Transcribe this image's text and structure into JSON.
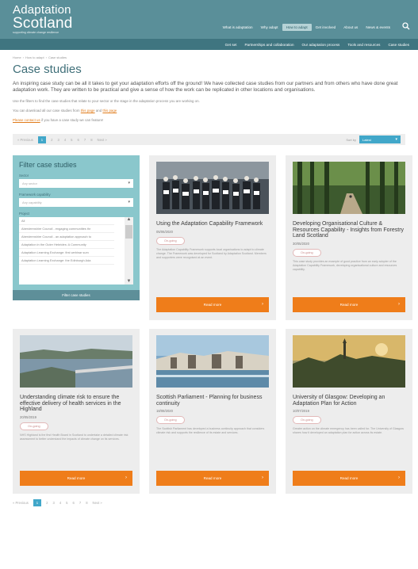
{
  "header": {
    "logo_line1": "Adaptation",
    "logo_line2": "Scotland",
    "logo_tagline": "supporting climate change resilience",
    "nav": [
      "What is adaptation",
      "Why adapt",
      "How to adapt",
      "Get involved",
      "About us",
      "News & events"
    ],
    "nav_active_index": 2,
    "subnav": [
      "Get set",
      "Partnerships and collaboration",
      "Our adaptation process",
      "Tools and resources",
      "Case studies"
    ]
  },
  "breadcrumb": [
    "Home",
    "How to adapt",
    "Case studies"
  ],
  "page": {
    "title": "Case studies",
    "intro": "An inspiring case study can be all it takes to get your adaptation efforts off the ground! We have collected case studies from our partners and from others who have done great adaptation work. They are written to be practical and give a sense of how the work can be replicated in other locations and organisations.",
    "filter_hint": "Use the filters to find the case studies that relate to your sector or the stage in the adaptation process you are working on.",
    "download_text": "You can download all our case studies from",
    "download_link1": "this page",
    "download_and": "and",
    "download_link2": "this page",
    "contact_link": "Please contact us",
    "contact_text": "if you have a case study we can feature!"
  },
  "pager": {
    "prev": "« Previous",
    "pages": [
      "1",
      "2",
      "3",
      "4",
      "5",
      "6",
      "7",
      "8"
    ],
    "current": "1",
    "next": "Next »",
    "sort_label": "Sort by",
    "sort_value": "Latest"
  },
  "filter": {
    "title": "Filter case studies",
    "sector_label": "Sector",
    "sector_placeholder": "Any sector",
    "capability_label": "Framework capability",
    "capability_placeholder": "Any capability",
    "project_label": "Project",
    "projects": [
      "All",
      "Aberdeenshire Council - engaging communities thr",
      "Aberdeenshire Council - an adaptation approach to",
      "Adaptation in the Outer Hebrides: A Community",
      "Adaptation Learning Exchange: first webinar sum",
      "Adaptation Learning Exchange: the Edinburgh Ada"
    ],
    "button": "Filter case studies"
  },
  "cards": [
    {
      "title": "Using the Adaptation Capability Framework",
      "date": "05/06/2020",
      "badge": "On-going",
      "desc": "The Adaptation Capability Framework supports local organisations to adapt to climate change. The Framework was developed for Scotland by Adaptation Scotland. Members and supporters were recognised at an event.",
      "button": "Read more"
    },
    {
      "title": "Developing Organisational Culture & Resources Capability - Insights from Forestry Land Scotland",
      "date": "30/05/2020",
      "badge": "On-going",
      "desc": "This case study provides an example of good practice from an early adopter of the Adaptation Capability Framework, developing organisational culture and resources capability.",
      "button": "Read more"
    },
    {
      "title": "Understanding climate risk to ensure the effective delivery of health services in the Highland",
      "date": "20/05/2019",
      "badge": "On-going",
      "desc": "NHS Highland is the first Health Board in Scotland to undertake a detailed climate risk assessment to better understand the impacts of climate change on its services.",
      "button": "Read more"
    },
    {
      "title": "Scottish Parliament - Planning for business continuity",
      "date": "18/08/2020",
      "badge": "On-going",
      "desc": "The Scottish Parliament has developed a business continuity approach that considers climate risk and supports the resilience of its estate and services.",
      "button": "Read more"
    },
    {
      "title": "University of Glasgow: Developing an Adaptation Plan for Action",
      "date": "10/07/2019",
      "badge": "On-going",
      "desc": "Greater action on the climate emergency has been called for. The University of Glasgow shares how it developed an adaptation plan for action across its estate.",
      "button": "Read more"
    }
  ]
}
